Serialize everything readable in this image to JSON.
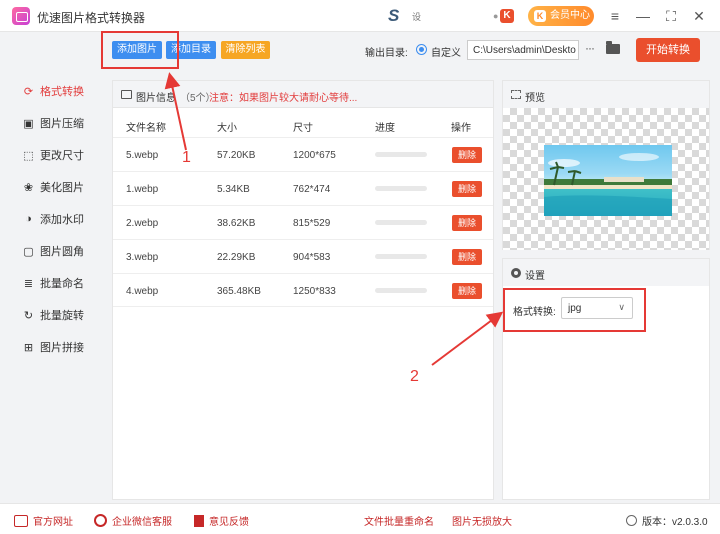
{
  "app": {
    "title": "优速图片格式转换器",
    "tray_label": "S",
    "tray_sub": "设",
    "vip_label": "会员中心",
    "vip_badge": "K",
    "k_badge": "K",
    "k_dot": "●"
  },
  "window": {
    "menu": "≡",
    "minimize": "—",
    "maximize": "⛶",
    "close": "✕"
  },
  "sidebar": {
    "items": [
      {
        "label": "格式转换",
        "icon": "⟳"
      },
      {
        "label": "图片压缩",
        "icon": "▣"
      },
      {
        "label": "更改尺寸",
        "icon": "⬚"
      },
      {
        "label": "美化图片",
        "icon": "❀"
      },
      {
        "label": "添加水印",
        "icon": "◑"
      },
      {
        "label": "图片圆角",
        "icon": "▢"
      },
      {
        "label": "批量命名",
        "icon": "≣"
      },
      {
        "label": "批量旋转",
        "icon": "↻"
      },
      {
        "label": "图片拼接",
        "icon": "⊞"
      }
    ]
  },
  "toolbar": {
    "add_image": "添加图片",
    "add_dir": "添加目录",
    "clear_list": "清除列表",
    "output_label": "输出目录:",
    "output_mode": "自定义",
    "output_path": "C:\\Users\\admin\\Deskto",
    "more": "···",
    "start": "开始转换"
  },
  "file_panel": {
    "title": "图片信息",
    "count": "（5个）",
    "notice": "注意：如果图片较大请耐心等待...",
    "columns": [
      "文件名称",
      "大小",
      "尺寸",
      "进度",
      "操作"
    ],
    "delete_label": "删除",
    "rows": [
      {
        "name": "5.webp",
        "size": "57.20KB",
        "dims": "1200*675",
        "progress": 0
      },
      {
        "name": "1.webp",
        "size": "5.34KB",
        "dims": "762*474",
        "progress": 0
      },
      {
        "name": "2.webp",
        "size": "38.62KB",
        "dims": "815*529",
        "progress": 0
      },
      {
        "name": "3.webp",
        "size": "22.29KB",
        "dims": "904*583",
        "progress": 0
      },
      {
        "name": "4.webp",
        "size": "365.48KB",
        "dims": "1250*833",
        "progress": 0
      }
    ]
  },
  "preview": {
    "title": "预览"
  },
  "settings": {
    "title": "设置",
    "format_label": "格式转换:",
    "format_value": "jpg",
    "chevron": "∨"
  },
  "annotations": {
    "one": "1",
    "two": "2",
    "color": "#e53935"
  },
  "footer": {
    "website": "官方网址",
    "wechat": "企业微信客服",
    "feedback": "意见反馈",
    "batch_rename": "文件批量重命名",
    "lossless": "图片无损放大",
    "version": "版本：v2.0.3.0"
  },
  "colors": {
    "accent_red": "#ea4f2d",
    "blue": "#3d8ef0",
    "orange": "#f6a623"
  }
}
